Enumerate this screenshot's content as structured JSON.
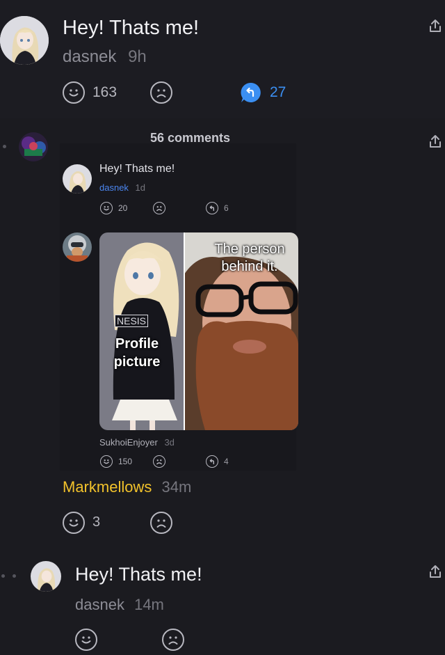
{
  "post1": {
    "title": "Hey! Thats me!",
    "author": "dasnek",
    "time": "9h",
    "likes": "163",
    "replies": "27"
  },
  "comment1": {
    "comments_label": "56 comments",
    "embed": {
      "title": "Hey! Thats me!",
      "author": "dasnek",
      "time": "1d",
      "likes": "20",
      "replies": "6"
    },
    "meme": {
      "left_caption": "Profile picture",
      "right_caption": "The person behind it.",
      "hoodie_text": "NESIS"
    },
    "image_author": "SukhoiEnjoyer",
    "image_time": "3d",
    "image_likes": "150",
    "image_replies": "4",
    "author": "Markmellows",
    "time": "34m",
    "likes": "3"
  },
  "post2": {
    "title": "Hey! Thats me!",
    "author": "dasnek",
    "time": "14m"
  },
  "colors": {
    "background": "#1b1b20",
    "accent_blue": "#3b8ff2",
    "author_yellow": "#f2c22b",
    "embed_author_blue": "#4b86f0"
  }
}
